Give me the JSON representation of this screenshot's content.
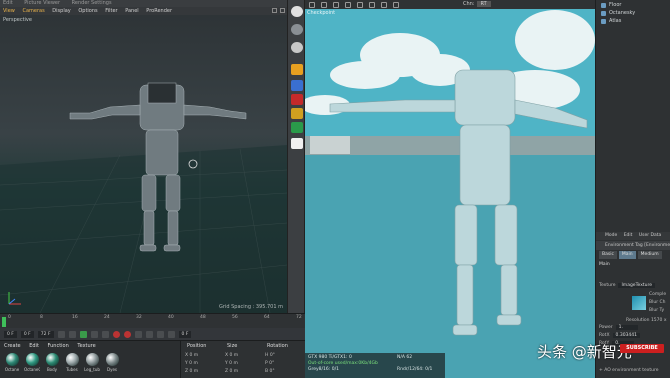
{
  "app": {
    "top_menu": [
      "Edit",
      "Picture Viewer",
      "Render Settings"
    ]
  },
  "viewport": {
    "menu": [
      "View",
      "Cameras",
      "Display",
      "Options",
      "Filter",
      "Panel",
      "ProRender"
    ],
    "label": "Perspective",
    "grid_spacing": "Grid Spacing : 395.701 m"
  },
  "render_view": {
    "title": "Checkpoint",
    "channel_label": "Chn:",
    "channel_value": "RT",
    "info_lines": [
      "GTX 980 Ti/GTX1: 0",
      "Out-of-core used/max:0Kb/4Gb",
      "Grey8/16: 0/1"
    ],
    "info_right": [
      "N/A 62",
      "Rndr/12/64: 0/1"
    ]
  },
  "object_manager": {
    "items": [
      "Floor",
      "Octanesky",
      "Atlas"
    ]
  },
  "attributes": {
    "tabs": [
      "Mode",
      "Edit",
      "User Data"
    ],
    "tag_title": "Environment Tag [Environmen",
    "subtabs": [
      "Basic",
      "Main",
      "Medium"
    ],
    "subtab_selected": "Main",
    "section": "Main",
    "texture_label": "Texture",
    "texture_value": "ImageTexture",
    "texture_lines": [
      "Comple",
      "Blur Ch",
      "Blur Ty"
    ],
    "resolution": "Resolution 1570 x",
    "power_label": "Power",
    "power_value": "1.",
    "rotx_label": "RotX",
    "rotx_value": "0.303441",
    "roty_label": "RotY",
    "roty_value": "0.",
    "footer": "+ AO environment texture"
  },
  "timeline": {
    "ticks": [
      "0",
      "8",
      "16",
      "24",
      "32",
      "40",
      "48",
      "56",
      "64",
      "72"
    ],
    "frame_start": "0 F",
    "frame_a": "0 F",
    "frame_end": "72 F",
    "frame_current": "0 F"
  },
  "materials": {
    "menu": [
      "Create",
      "Edit",
      "Function",
      "Texture"
    ],
    "items": [
      {
        "label": "Octane",
        "color": "#2e8a76"
      },
      {
        "label": "OctaneG",
        "color": "#2f9a82"
      },
      {
        "label": "Body",
        "color": "#2c8c74"
      },
      {
        "label": "Tubes",
        "color": "#9aa6a8"
      },
      {
        "label": "Leg_tub",
        "color": "#8c9799"
      },
      {
        "label": "Dyes",
        "color": "#7f8b8c"
      }
    ]
  },
  "coordinates": {
    "headers": [
      "Position",
      "Size",
      "Rotation"
    ],
    "rows": [
      [
        "X 0 m",
        "X 0 m",
        "H 0°"
      ],
      [
        "Y 0 m",
        "Y 0 m",
        "P 0°"
      ],
      [
        "Z 0 m",
        "Z 0 m",
        "B 0°"
      ]
    ]
  },
  "overlay": {
    "watermark": "头条 @新智元",
    "subscribe": "SUBSCRIBE"
  },
  "colors": {
    "accent": "#e8b24a",
    "render_sky": "#4aa8ba",
    "selected_tab": "#5e7a8e"
  }
}
